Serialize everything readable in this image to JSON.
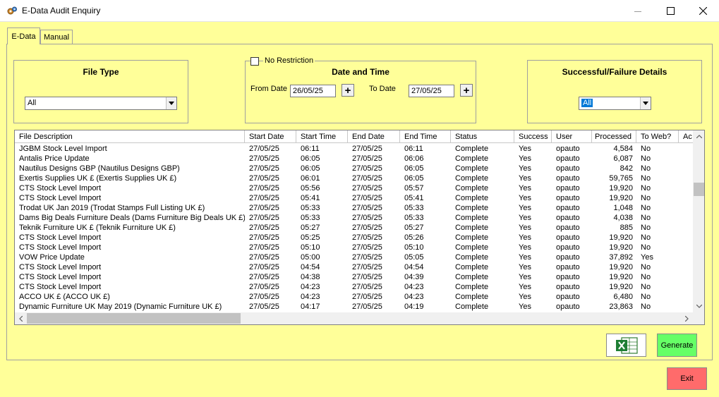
{
  "window": {
    "title": "E-Data Audit Enquiry",
    "controls": {
      "minimize": "–",
      "maximize": "☐",
      "close": "✕"
    }
  },
  "tabs": [
    {
      "label": "E-Data",
      "active": true
    },
    {
      "label": "Manual",
      "active": false
    }
  ],
  "file_type": {
    "title": "File Type",
    "selected": "All"
  },
  "date_time": {
    "no_restriction_label": "No Restriction",
    "no_restriction_checked": false,
    "title": "Date and Time",
    "from_label": "From Date",
    "from_value": "26/05/25",
    "to_label": "To Date",
    "to_value": "27/05/25",
    "picker_glyph": "+"
  },
  "success_failure": {
    "title": "Successful/Failure Details",
    "selected": "All"
  },
  "grid": {
    "columns": [
      "File Description",
      "Start Date",
      "Start Time",
      "End Date",
      "End Time",
      "Status",
      "Success",
      "User",
      "Processed",
      "To Web?",
      "Ac"
    ],
    "rows": [
      [
        "JGBM Stock Level Import",
        "27/05/25",
        "06:11",
        "27/05/25",
        "06:11",
        "Complete",
        "Yes",
        "opauto",
        "4,584",
        "No"
      ],
      [
        "Antalis Price Update",
        "27/05/25",
        "06:05",
        "27/05/25",
        "06:06",
        "Complete",
        "Yes",
        "opauto",
        "6,087",
        "No"
      ],
      [
        "Nautilus Designs GBP (Nautilus Designs GBP)",
        "27/05/25",
        "06:05",
        "27/05/25",
        "06:05",
        "Complete",
        "Yes",
        "opauto",
        "842",
        "No"
      ],
      [
        "Exertis Supplies UK £ (Exertis Supplies UK £)",
        "27/05/25",
        "06:01",
        "27/05/25",
        "06:05",
        "Complete",
        "Yes",
        "opauto",
        "59,765",
        "No"
      ],
      [
        "CTS Stock Level Import",
        "27/05/25",
        "05:56",
        "27/05/25",
        "05:57",
        "Complete",
        "Yes",
        "opauto",
        "19,920",
        "No"
      ],
      [
        "CTS Stock Level Import",
        "27/05/25",
        "05:41",
        "27/05/25",
        "05:41",
        "Complete",
        "Yes",
        "opauto",
        "19,920",
        "No"
      ],
      [
        "Trodat UK Jan 2019 (Trodat Stamps Full Listing UK £)",
        "27/05/25",
        "05:33",
        "27/05/25",
        "05:33",
        "Complete",
        "Yes",
        "opauto",
        "1,048",
        "No"
      ],
      [
        "Dams Big Deals Furniture Deals (Dams Furniture Big Deals UK £)",
        "27/05/25",
        "05:33",
        "27/05/25",
        "05:33",
        "Complete",
        "Yes",
        "opauto",
        "4,038",
        "No"
      ],
      [
        "Teknik Furniture UK £ (Teknik Furniture UK £)",
        "27/05/25",
        "05:27",
        "27/05/25",
        "05:27",
        "Complete",
        "Yes",
        "opauto",
        "885",
        "No"
      ],
      [
        "CTS Stock Level Import",
        "27/05/25",
        "05:25",
        "27/05/25",
        "05:26",
        "Complete",
        "Yes",
        "opauto",
        "19,920",
        "No"
      ],
      [
        "CTS Stock Level Import",
        "27/05/25",
        "05:10",
        "27/05/25",
        "05:10",
        "Complete",
        "Yes",
        "opauto",
        "19,920",
        "No"
      ],
      [
        "VOW Price Update",
        "27/05/25",
        "05:00",
        "27/05/25",
        "05:05",
        "Complete",
        "Yes",
        "opauto",
        "37,892",
        "Yes"
      ],
      [
        "CTS Stock Level Import",
        "27/05/25",
        "04:54",
        "27/05/25",
        "04:54",
        "Complete",
        "Yes",
        "opauto",
        "19,920",
        "No"
      ],
      [
        "CTS Stock Level Import",
        "27/05/25",
        "04:38",
        "27/05/25",
        "04:39",
        "Complete",
        "Yes",
        "opauto",
        "19,920",
        "No"
      ],
      [
        "CTS Stock Level Import",
        "27/05/25",
        "04:23",
        "27/05/25",
        "04:23",
        "Complete",
        "Yes",
        "opauto",
        "19,920",
        "No"
      ],
      [
        "ACCO UK £ (ACCO UK £)",
        "27/05/25",
        "04:23",
        "27/05/25",
        "04:23",
        "Complete",
        "Yes",
        "opauto",
        "6,480",
        "No"
      ],
      [
        "Dynamic Furniture UK May 2019 (Dynamic Furniture UK £)",
        "27/05/25",
        "04:17",
        "27/05/25",
        "04:19",
        "Complete",
        "Yes",
        "opauto",
        "23,863",
        "No"
      ]
    ]
  },
  "buttons": {
    "excel_icon": "excel-icon",
    "generate": "Generate",
    "exit": "Exit"
  },
  "colors": {
    "background": "#ffff99",
    "generate": "#66ff66",
    "exit": "#ff6b6b",
    "selection": "#0078d7"
  }
}
